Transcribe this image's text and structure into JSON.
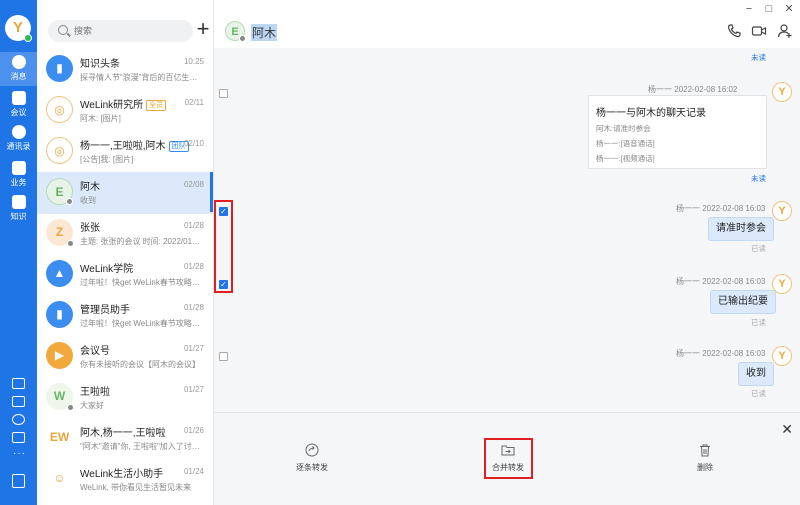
{
  "nav": {
    "avatar_letter": "Y",
    "items": [
      {
        "label": "消息"
      },
      {
        "label": "会议"
      },
      {
        "label": "通讯录"
      },
      {
        "label": "业务"
      },
      {
        "label": "知识"
      }
    ]
  },
  "list": {
    "search_placeholder": "搜索",
    "add_label": "+",
    "conversations": [
      {
        "name": "知识头条",
        "tag": "",
        "time": "10:25",
        "preview": "探寻情人节“浪漫”背后的百亿生…",
        "avatar": "▮",
        "color": "#3b8ef0"
      },
      {
        "name": "WeLink研究所",
        "tag": "全员",
        "time": "02/11",
        "preview": "阿木: [图片]",
        "avatar": "◎",
        "color": "#ffffff"
      },
      {
        "name": "杨一一,王啦啦,阿木",
        "tag": "团队",
        "time": "02/10",
        "preview": "[公告]我: [图片]",
        "avatar": "◎",
        "color": "#ffffff"
      },
      {
        "name": "阿木",
        "tag": "",
        "time": "02/08",
        "preview": "收到",
        "avatar": "E",
        "color": "#e6f3e6"
      },
      {
        "name": "张张",
        "tag": "",
        "time": "01/28",
        "preview": "主题: 张张的会议 时间: 2022/01/…",
        "avatar": "Z",
        "color": "#fbe7d4"
      },
      {
        "name": "WeLink学院",
        "tag": "",
        "time": "01/28",
        "preview": "过年啦！快get WeLink春节攻略…",
        "avatar": "▲",
        "color": "#3b8ef0"
      },
      {
        "name": "管理员助手",
        "tag": "",
        "time": "01/28",
        "preview": "过年啦！快get WeLink春节攻略…",
        "avatar": "▮",
        "color": "#3b8ef0"
      },
      {
        "name": "会议号",
        "tag": "",
        "time": "01/27",
        "preview": "你有未接听的会议【阿木的会议】",
        "avatar": "▶",
        "color": "#f2a93b"
      },
      {
        "name": "王啦啦",
        "tag": "",
        "time": "01/27",
        "preview": "大家好",
        "avatar": "W",
        "color": "#eef6ea"
      },
      {
        "name": "阿木,杨一一,王啦啦",
        "tag": "",
        "time": "01/26",
        "preview": "\"阿木\"邀请\"你, 王啦啦\"加入了讨…",
        "avatar": "EW",
        "color": "#ffffff"
      },
      {
        "name": "WeLink生活小助手",
        "tag": "",
        "time": "01/24",
        "preview": "WeLink, 带你看见生活暂见未来",
        "avatar": "☺",
        "color": "#ffffff"
      }
    ]
  },
  "chat": {
    "title": "阿木",
    "avatar_letter": "E",
    "messages": {
      "top_status": "未读",
      "card": {
        "sender_time": "杨一一  2022-02-08 16:02",
        "title": "杨一一与阿木的聊天记录",
        "lines": [
          "阿木:请准时参会",
          "杨一一:[语音通话]",
          "杨一一:[视频通话]"
        ],
        "status": "未读"
      },
      "m1": {
        "sender_time": "杨一一  2022-02-08 16:03",
        "text": "请准时参会",
        "status": "已读"
      },
      "m2": {
        "sender_time": "杨一一  2022-02-08 16:03",
        "text": "已输出纪要",
        "status": "已读"
      },
      "m3": {
        "sender_time": "杨一一  2022-02-08 16:03",
        "text": "收到",
        "status": "已读"
      },
      "sender_avatar": "Y"
    },
    "actions": {
      "forward_each": "逐条转发",
      "forward_merged": "合并转发",
      "delete": "删除",
      "close": "✕"
    },
    "window": {
      "minimize": "−",
      "maximize": "□",
      "close": "✕"
    }
  }
}
